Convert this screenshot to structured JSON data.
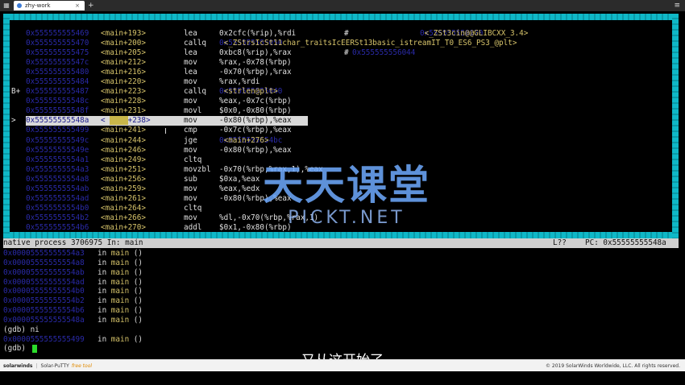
{
  "browser": {
    "tab_title": "zhy-work",
    "close_glyph": "×",
    "plus_glyph": "+",
    "menu_glyph": "≡",
    "left_icon": "grid-icon"
  },
  "tui": {
    "lines": [
      {
        "marker": "",
        "addr": "0x555555555469",
        "sym": "<main+193>",
        "mn": "lea",
        "op": "0x2cfc(%rip),%rdi",
        "comment": "#",
        "tag": "0x555555558170",
        "tname": " <_ZSt3cin@@GLIBCXX_3.4>"
      },
      {
        "marker": "",
        "addr": "0x555555555470",
        "sym": "<main+200>",
        "mn": "callq",
        "op": "",
        "comment": "",
        "tag": "0x555555555050",
        "tname": " <_ZStrsIcSt11char_traitsIcEERSt13basic_istreamIT_T0_ES6_PS3_@plt>"
      },
      {
        "marker": "",
        "addr": "0x555555555475",
        "sym": "<main+205>",
        "mn": "lea",
        "op": "0xbc8(%rip),%rax",
        "comment": "#",
        "tag": "0x555555556044",
        "tname": ""
      },
      {
        "marker": "",
        "addr": "0x55555555547c",
        "sym": "<main+212>",
        "mn": "mov",
        "op": "%rax,-0x78(%rbp)",
        "comment": "",
        "tag": "",
        "tname": ""
      },
      {
        "marker": "",
        "addr": "0x555555555480",
        "sym": "<main+216>",
        "mn": "lea",
        "op": "-0x70(%rbp),%rax",
        "comment": "",
        "tag": "",
        "tname": ""
      },
      {
        "marker": "",
        "addr": "0x555555555484",
        "sym": "<main+220>",
        "mn": "mov",
        "op": "%rax,%rdi",
        "comment": "",
        "tag": "",
        "tname": ""
      },
      {
        "marker": "B+",
        "addr": "0x555555555487",
        "sym": "<main+223>",
        "mn": "callq",
        "op": "",
        "comment": "",
        "tag": "0x555555555040",
        "tname": " <strlen@plt>"
      },
      {
        "marker": "",
        "addr": "0x55555555548c",
        "sym": "<main+228>",
        "mn": "mov",
        "op": "%eax,-0x7c(%rbp)",
        "comment": "",
        "tag": "",
        "tname": ""
      },
      {
        "marker": "",
        "addr": "0x55555555548f",
        "sym": "<main+231>",
        "mn": "movl",
        "op": "$0x0,-0x80(%rbp)",
        "comment": "",
        "tag": "",
        "tname": ""
      },
      {
        "marker": ">",
        "addr": "0x55555555548a",
        "sym": "<main+238>",
        "mn": "mov",
        "op": "-0x80(%rbp),%eax",
        "comment": "",
        "tag": "",
        "tname": "",
        "current": true
      },
      {
        "marker": "",
        "addr": "0x555555555499",
        "sym": "<main+241>",
        "mn": "cmp",
        "op": "-0x7c(%rbp),%eax",
        "comment": "",
        "tag": "",
        "tname": ""
      },
      {
        "marker": "",
        "addr": "0x55555555549c",
        "sym": "<main+244>",
        "mn": "jge",
        "op": "",
        "comment": "",
        "tag": "0x5555555554bc",
        "tname": " <main+276>"
      },
      {
        "marker": "",
        "addr": "0x55555555549e",
        "sym": "<main+246>",
        "mn": "mov",
        "op": "-0x80(%rbp),%eax",
        "comment": "",
        "tag": "",
        "tname": ""
      },
      {
        "marker": "",
        "addr": "0x5555555554a1",
        "sym": "<main+249>",
        "mn": "cltq",
        "op": "",
        "comment": "",
        "tag": "",
        "tname": ""
      },
      {
        "marker": "",
        "addr": "0x5555555554a3",
        "sym": "<main+251>",
        "mn": "movzbl",
        "op": "-0x70(%rbp,%rax,1),%eax",
        "comment": "",
        "tag": "",
        "tname": ""
      },
      {
        "marker": "",
        "addr": "0x5555555554a8",
        "sym": "<main+256>",
        "mn": "sub",
        "op": "$0xa,%eax",
        "comment": "",
        "tag": "",
        "tname": ""
      },
      {
        "marker": "",
        "addr": "0x5555555554ab",
        "sym": "<main+259>",
        "mn": "mov",
        "op": "%eax,%edx",
        "comment": "",
        "tag": "",
        "tname": ""
      },
      {
        "marker": "",
        "addr": "0x5555555554ad",
        "sym": "<main+261>",
        "mn": "mov",
        "op": "-0x80(%rbp),%eax",
        "comment": "",
        "tag": "",
        "tname": ""
      },
      {
        "marker": "",
        "addr": "0x5555555554b0",
        "sym": "<main+264>",
        "mn": "cltq",
        "op": "",
        "comment": "",
        "tag": "",
        "tname": ""
      },
      {
        "marker": "",
        "addr": "0x5555555554b2",
        "sym": "<main+266>",
        "mn": "mov",
        "op": "%dl,-0x70(%rbp,%rax,1)",
        "comment": "",
        "tag": "",
        "tname": ""
      },
      {
        "marker": "",
        "addr": "0x5555555554b6",
        "sym": "<main+270>",
        "mn": "addl",
        "op": "$0x1,-0x80(%rbp)",
        "comment": "",
        "tag": "",
        "tname": ""
      }
    ]
  },
  "status": {
    "process": "native process 3706975 In: main",
    "line": "L??",
    "pc": "PC: 0x55555555548a"
  },
  "cmd": {
    "history": [
      {
        "addr": "0x00005555555554a3",
        "in": "in",
        "fn": "main",
        "args": "()"
      },
      {
        "addr": "0x00005555555554a8",
        "in": "in",
        "fn": "main",
        "args": "()"
      },
      {
        "addr": "0x00005555555554ab",
        "in": "in",
        "fn": "main",
        "args": "()"
      },
      {
        "addr": "0x00005555555554ad",
        "in": "in",
        "fn": "main",
        "args": "()"
      },
      {
        "addr": "0x00005555555554b0",
        "in": "in",
        "fn": "main",
        "args": "()"
      },
      {
        "addr": "0x00005555555554b2",
        "in": "in",
        "fn": "main",
        "args": "()"
      },
      {
        "addr": "0x00005555555554b6",
        "in": "in",
        "fn": "main",
        "args": "()"
      },
      {
        "addr": "0x000055555555548a",
        "in": "in",
        "fn": "main",
        "args": "()"
      }
    ],
    "ni_prompt": "(gdb) ni",
    "last": {
      "addr": "0x0000555555555499",
      "in": "in",
      "fn": "main",
      "args": "()"
    },
    "prompt": "(gdb) "
  },
  "watermark": {
    "cn": "天天课堂",
    "en": "PICKT.NET"
  },
  "subtitle": "又从这开始了",
  "footer": {
    "brand": "solarwinds",
    "product": "Solar-PuTTY",
    "free": "free tool",
    "copyright": "© 2019 SolarWinds Worldwide, LLC. All rights reserved."
  }
}
